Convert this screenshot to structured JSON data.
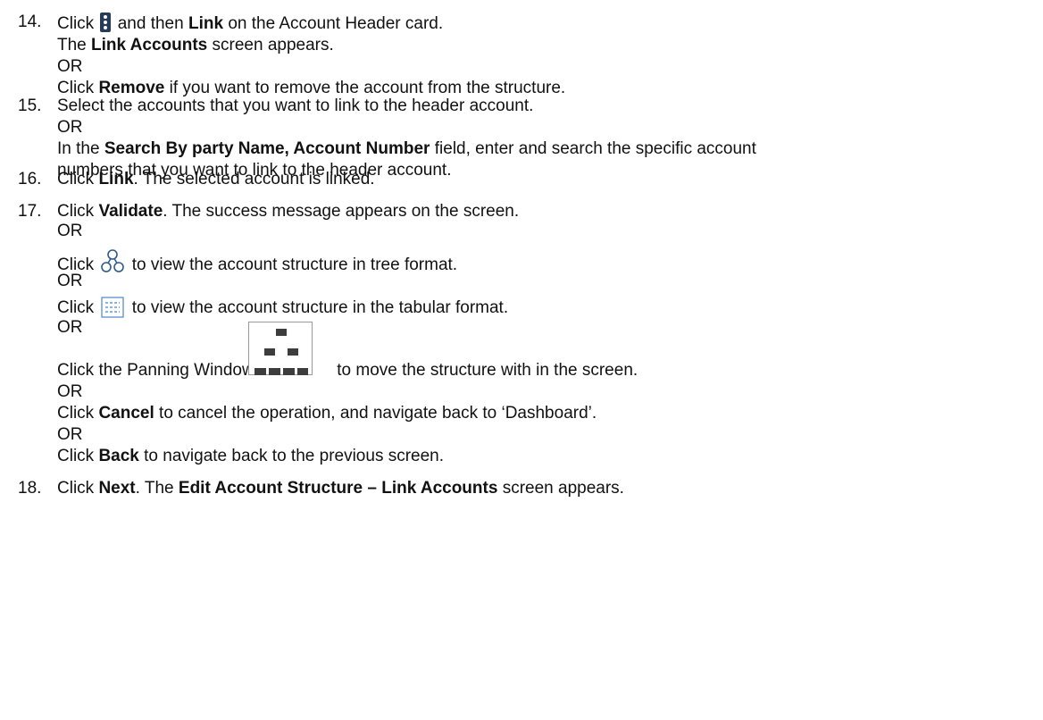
{
  "steps": [
    {
      "number": "14.",
      "lines": {
        "l1_a": "Click",
        "l1_b": "and then",
        "l1_bold": "Link",
        "l1_c": "on the Account Header card.",
        "l2_a": "The",
        "l2_bold": "Link Accounts",
        "l2_b": "screen appears.",
        "l3": "OR",
        "l4_a": "Click",
        "l4_bold": "Remove",
        "l4_b": "if you want to remove the account from the structure."
      },
      "icon": "kebab-menu-icon"
    },
    {
      "number": "15.",
      "lines": {
        "l1": "Select the accounts that you want to link to the header account.",
        "l2": "OR",
        "l3_a": "In the",
        "l3_bold": "Search By party Name, Account Number",
        "l3_b": "field, enter and search the specific account",
        "l4": "numbers that you want to link to the header account."
      }
    },
    {
      "number": "16.",
      "lines": {
        "l1_a": "Click",
        "l1_bold": "Link",
        "l1_b": ". The selected account is linked."
      }
    },
    {
      "number": "17.",
      "lines": {
        "l1_a": "Click",
        "l1_bold": "Validate",
        "l1_b": ". The success message appears on the screen.",
        "l2": "OR",
        "l3_a": "Click",
        "l3_b": "to view the account structure in tree format.",
        "l4": "OR",
        "l5_a": "Click",
        "l5_b": "to view the account structure in the tabular format.",
        "l6": "OR",
        "l7_a": "Click the Panning Window",
        "l7_b": "to move the structure with in the screen.",
        "l8": "OR",
        "l9_a": "Click",
        "l9_bold": "Cancel",
        "l9_b": "to cancel the operation, and navigate back to ‘Dashboard’.",
        "l10": "OR",
        "l11_a": "Click",
        "l11_bold": "Back",
        "l11_b": "to navigate back to the previous screen."
      },
      "icons": [
        "tree-view-icon",
        "tabular-view-icon",
        "panning-window-icon"
      ]
    },
    {
      "number": "18.",
      "lines": {
        "l1_a": "Click",
        "l1_bold": "Next",
        "l1_b": ". The",
        "l1_bold2": "Edit Account Structure – Link Accounts",
        "l1_c": "screen appears."
      }
    }
  ],
  "colors": {
    "text": "#111111",
    "kebab": "#263a5a",
    "tree_icon": "#2d5a8c",
    "grid_icon": "#4a86c8",
    "pan_blocks": "#3d3d3d"
  }
}
